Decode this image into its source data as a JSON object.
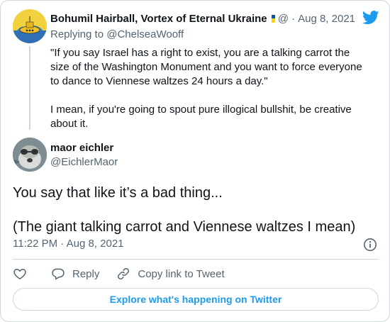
{
  "parent_tweet": {
    "author_name": "Bohumil Hairball, Vortex of Eternal Ukraine",
    "handle_truncated": "@",
    "separator": "·",
    "date": "Aug 8, 2021",
    "replying_prefix": "Replying to",
    "replying_to": "@ChelseaWooff",
    "paragraphs": [
      "\"If you say Israel has a right to exist, you are a talking carrot the size of the Washington Monument and you want to force everyone to dance to Viennese waltzes 24 hours a day.\"",
      "I mean, if you're going to spout pure illogical bullshit, be creative about it."
    ]
  },
  "main_tweet": {
    "author_name": "maor eichler",
    "handle": "@EichlerMaor",
    "paragraphs": [
      "You say that like it’s a bad thing...",
      "(The giant talking carrot and Viennese waltzes I mean)"
    ],
    "time": "11:22 PM",
    "separator": "·",
    "date": "Aug 8, 2021"
  },
  "actions": {
    "reply_label": "Reply",
    "copy_link_label": "Copy link to Tweet"
  },
  "explore_label": "Explore what's happening on Twitter",
  "icons": {
    "brand": "twitter-bird-icon",
    "like": "heart-icon",
    "reply": "speech-bubble-icon",
    "copy_link": "link-icon",
    "info": "info-icon"
  },
  "colors": {
    "accent": "#1d9bf0",
    "secondary_text": "#536471",
    "border": "#cfd9de",
    "flag_blue": "#0057b7",
    "flag_yellow": "#ffd700"
  }
}
